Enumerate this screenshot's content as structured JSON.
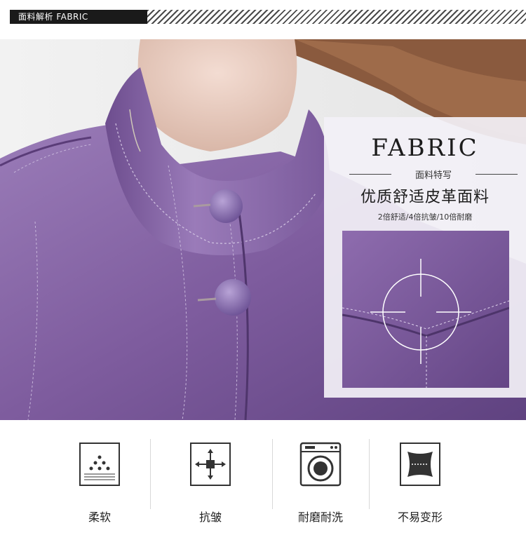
{
  "header": {
    "tab_label": "面料解析  FABRIC"
  },
  "panel": {
    "title": "FABRIC",
    "subtitle": "面料特写",
    "headline": "优质舒适皮革面料",
    "features": "2倍舒适/4倍抗皱/10倍耐磨"
  },
  "features": [
    {
      "label": "柔软",
      "icon": "softness-icon"
    },
    {
      "label": "抗皱",
      "icon": "anti-wrinkle-icon"
    },
    {
      "label": "耐磨耐洗",
      "icon": "washing-machine-icon"
    },
    {
      "label": "不易变形",
      "icon": "shape-retention-icon"
    }
  ],
  "colors": {
    "leather": "#8b6aa8",
    "accent": "#1a1a1a"
  }
}
